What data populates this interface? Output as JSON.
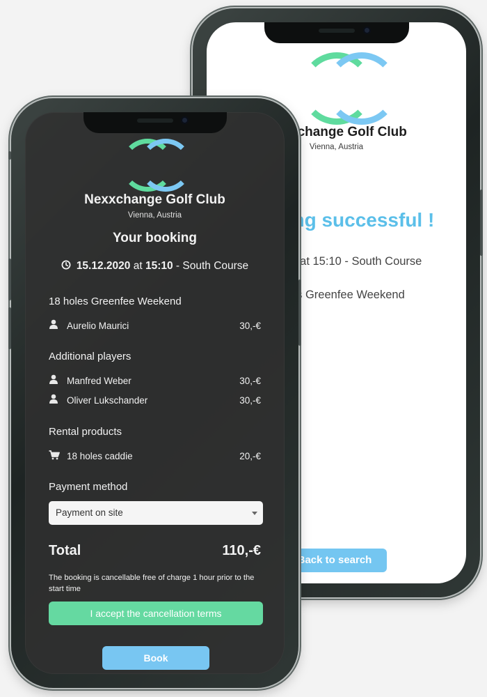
{
  "back_screen": {
    "club_name": "Nexxchange Golf Club",
    "city": "Vienna, Austria",
    "success_title": "Booking successful !",
    "datetime_line": "15.12.2020 at 15:10 - South Course",
    "product_line": "18 holes Greenfee Weekend",
    "back_button": "Back to search"
  },
  "front_screen": {
    "club_name": "Nexxchange Golf Club",
    "city": "Vienna, Austria",
    "heading": "Your booking",
    "date": "15.12.2020",
    "at": "at",
    "time": "15:10",
    "course": "- South Course",
    "greenfee": {
      "title": "18 holes Greenfee Weekend",
      "player": {
        "name": "Aurelio Maurici",
        "price": "30,-€"
      }
    },
    "additional_players": {
      "title": "Additional players",
      "players": [
        {
          "name": "Manfred Weber",
          "price": "30,-€"
        },
        {
          "name": "Oliver Lukschander",
          "price": "30,-€"
        }
      ]
    },
    "rental_products": {
      "title": "Rental products",
      "items": [
        {
          "name": "18 holes caddie",
          "price": "20,-€"
        }
      ]
    },
    "payment": {
      "title": "Payment method",
      "selected": "Payment on site"
    },
    "total_label": "Total",
    "total_value": "110,-€",
    "cancellation_note": "The booking is cancellable free of charge 1 hour prior to the start time",
    "accept_button": "I accept the cancellation terms",
    "book_button": "Book"
  },
  "colors": {
    "logo_green": "#5fdb9e",
    "logo_blue": "#7cc8f3",
    "accent_blue": "#5bbfe9",
    "accept_green": "#65d9a1",
    "book_blue": "#78c6f2"
  },
  "icons": {
    "clock": "clock-icon",
    "user": "user-icon",
    "cart": "cart-icon",
    "caret": "caret-down-icon"
  }
}
